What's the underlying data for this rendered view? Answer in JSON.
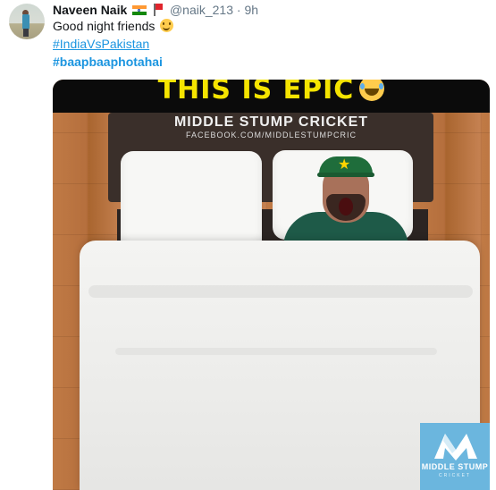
{
  "tweet": {
    "display_name": "Naveen Naik",
    "handle": "@naik_213",
    "separator": "·",
    "time": "9h",
    "text": "Good night friends",
    "hashtags": [
      "#IndiaVsPakistan",
      "#baapbaaphotahai"
    ],
    "icons": [
      "india-flag-icon",
      "red-flag-icon",
      "smiling-face-icon"
    ]
  },
  "media": {
    "banner_text": "THIS IS EPIC",
    "watermark_title": "MIDDLE STUMP CRICKET",
    "watermark_subtitle": "FACEBOOK.COM/MIDDLESTUMPCRIC",
    "logo_name": "MIDDLE STUMP",
    "logo_subtitle": "CRICKET",
    "icons": [
      "laughing-tears-emoji-icon"
    ]
  },
  "colors": {
    "link": "#1b95e0",
    "handle": "#657786",
    "banner_text": "#f5e400",
    "logo_bg": "#6bb6de"
  }
}
